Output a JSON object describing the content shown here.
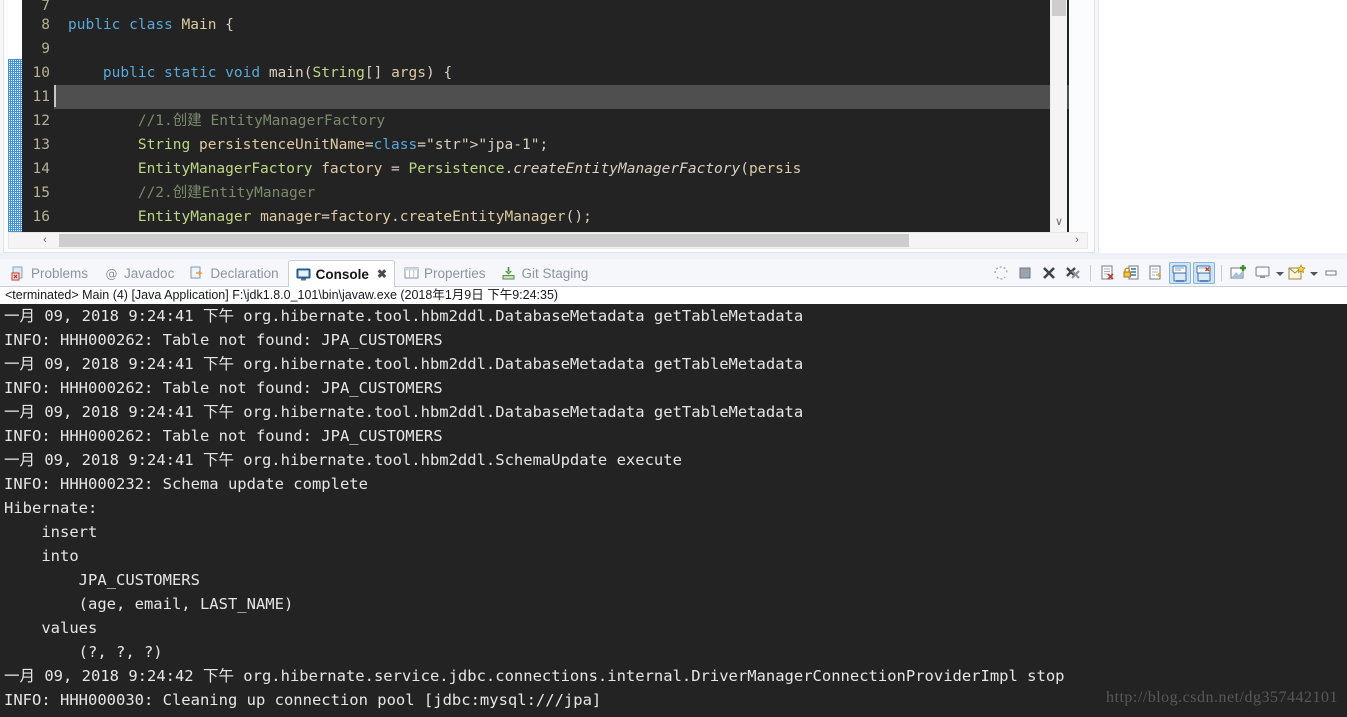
{
  "editor": {
    "lines": [
      {
        "num": "7",
        "partial": true,
        "highlight": false,
        "text": ""
      },
      {
        "num": "8",
        "partial": false,
        "highlight": false,
        "text": "public class Main {"
      },
      {
        "num": "9",
        "partial": false,
        "highlight": false,
        "text": ""
      },
      {
        "num": "10",
        "partial": false,
        "highlight": false,
        "text": "    public static void main(String[] args) {"
      },
      {
        "num": "11",
        "partial": false,
        "highlight": true,
        "text": ""
      },
      {
        "num": "12",
        "partial": false,
        "highlight": false,
        "text": "        //1.创建 EntityManagerFactory"
      },
      {
        "num": "13",
        "partial": false,
        "highlight": false,
        "text": "        String persistenceUnitName=\"jpa-1\";"
      },
      {
        "num": "14",
        "partial": false,
        "highlight": false,
        "text": "        EntityManagerFactory factory = Persistence.createEntityManagerFactory(persis"
      },
      {
        "num": "15",
        "partial": false,
        "highlight": false,
        "text": "        //2.创建EntityManager"
      },
      {
        "num": "16",
        "partial": false,
        "highlight": false,
        "text": "        EntityManager manager=factory.createEntityManager();"
      }
    ],
    "scroll_left_arrow": "‹",
    "scroll_right_arrow": "›",
    "scroll_down_arrow": "∨"
  },
  "tabbar": {
    "tabs": [
      {
        "label": "Problems",
        "icon": "problems-icon",
        "active": false,
        "closable": false
      },
      {
        "label": "Javadoc",
        "icon": "javadoc-icon",
        "active": false,
        "closable": false
      },
      {
        "label": "Declaration",
        "icon": "declaration-icon",
        "active": false,
        "closable": false
      },
      {
        "label": "Console",
        "icon": "console-icon",
        "active": true,
        "closable": true
      },
      {
        "label": "Properties",
        "icon": "properties-icon",
        "active": false,
        "closable": false
      },
      {
        "label": "Git Staging",
        "icon": "git-staging-icon",
        "active": false,
        "closable": false
      }
    ],
    "close_glyph": "✖",
    "toolbar": [
      {
        "name": "terminate-all-icon",
        "kind": "terminate-all",
        "active": false
      },
      {
        "name": "terminate-icon",
        "kind": "stop",
        "active": false
      },
      {
        "name": "remove-launch-icon",
        "kind": "x",
        "active": false
      },
      {
        "name": "remove-all-launches-icon",
        "kind": "xx",
        "active": false
      },
      {
        "name": "separator",
        "kind": "sep",
        "active": false
      },
      {
        "name": "clear-console-icon",
        "kind": "clear",
        "active": false
      },
      {
        "name": "scroll-lock-icon",
        "kind": "lock",
        "active": false
      },
      {
        "name": "word-wrap-icon",
        "kind": "wrap",
        "active": false
      },
      {
        "name": "show-console-on-output-icon",
        "kind": "showout",
        "active": true
      },
      {
        "name": "show-console-on-error-icon",
        "kind": "showerr",
        "active": true
      },
      {
        "name": "separator",
        "kind": "sep",
        "active": false
      },
      {
        "name": "pin-console-icon",
        "kind": "pin",
        "active": false
      },
      {
        "name": "display-selected-console-icon",
        "kind": "display",
        "active": false
      },
      {
        "name": "display-console-dropdown-icon",
        "kind": "caret",
        "active": false
      },
      {
        "name": "open-console-icon",
        "kind": "newconsole",
        "active": false
      },
      {
        "name": "open-console-dropdown-icon",
        "kind": "caret",
        "active": false
      },
      {
        "name": "view-menu-icon",
        "kind": "minimize",
        "active": false
      }
    ]
  },
  "console": {
    "header": "<terminated> Main (4) [Java Application] F:\\jdk1.8.0_101\\bin\\javaw.exe (2018年1月9日 下午9:24:35)",
    "lines": [
      "一月 09, 2018 9:24:41 下午 org.hibernate.tool.hbm2ddl.DatabaseMetadata getTableMetadata",
      "INFO: HHH000262: Table not found: JPA_CUSTOMERS",
      "一月 09, 2018 9:24:41 下午 org.hibernate.tool.hbm2ddl.DatabaseMetadata getTableMetadata",
      "INFO: HHH000262: Table not found: JPA_CUSTOMERS",
      "一月 09, 2018 9:24:41 下午 org.hibernate.tool.hbm2ddl.DatabaseMetadata getTableMetadata",
      "INFO: HHH000262: Table not found: JPA_CUSTOMERS",
      "一月 09, 2018 9:24:41 下午 org.hibernate.tool.hbm2ddl.SchemaUpdate execute",
      "INFO: HHH000232: Schema update complete",
      "Hibernate: ",
      "    insert ",
      "    into",
      "        JPA_CUSTOMERS",
      "        (age, email, LAST_NAME) ",
      "    values",
      "        (?, ?, ?)",
      "一月 09, 2018 9:24:42 下午 org.hibernate.service.jdbc.connections.internal.DriverManagerConnectionProviderImpl stop",
      "INFO: HHH000030: Cleaning up connection pool [jdbc:mysql:///jpa]"
    ],
    "watermark": "http://blog.csdn.net/dg357442101"
  },
  "colors": {
    "editor_bg": "#232323",
    "console_bg": "#232323",
    "highlight_line": "#4f4f4f",
    "chrome_bg": "#f6f7fb",
    "active_tab_bg": "#ffffff",
    "toolbar_active": "#cfe4f7"
  }
}
